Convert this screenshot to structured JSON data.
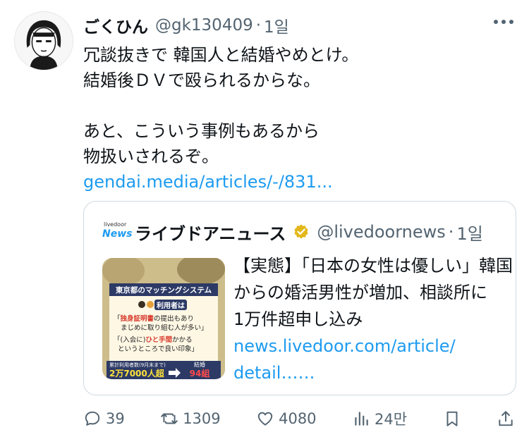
{
  "post": {
    "author_name": "ごくひん",
    "handle": "@gk130409",
    "separator": "·",
    "time": "1일",
    "lines": [
      "冗談抜きで 韓国人と結婚やめとけ。",
      "結婚後ＤＶで殴られるからな。",
      "",
      "あと、こういう事例もあるから",
      "物扱いされるぞ。"
    ],
    "link": "gendai.media/articles/-/831..."
  },
  "quote": {
    "logo_small": "livedoor",
    "logo_main": "News",
    "name": "ライブドアニュース",
    "handle": "@livedoornews",
    "separator": "·",
    "time": "1일",
    "text_lines": [
      "【実態】｢日本の女性は優しい」韓国",
      "からの婚活男性が増加、相談所に",
      "1万件超申し込み"
    ],
    "link_lines": [
      "news.livedoor.com/article/",
      "detail……"
    ],
    "thumbnail": {
      "title": "東京都のマッチングシステム",
      "badge": "利用者は",
      "quote1_hl": "独身証明書",
      "quote1_a": "の提出もあり",
      "quote1_b": "まじめに取り組む人が多い」",
      "quote2_a": "「(入会に)",
      "quote2_hl": "ひと手間",
      "quote2_b": "かかる",
      "quote2_c": "というところで良い印象」",
      "stat_label": "累計利用者数(9月末まで)",
      "stat_value": "2万7000人超",
      "marriage_label": "結婚",
      "marriage_value": "94組"
    }
  },
  "actions": {
    "replies": "39",
    "reposts": "1309",
    "likes": "4080",
    "views": "24만"
  },
  "colors": {
    "link": "#1d9bf0",
    "muted": "#536471",
    "text": "#0f1419",
    "border": "#cfd9de",
    "verified_gold": "#e2b719"
  },
  "icons": [
    "reply-icon",
    "repost-icon",
    "like-icon",
    "views-icon",
    "bookmark-icon",
    "share-icon",
    "more-icon",
    "verified-badge-icon"
  ]
}
